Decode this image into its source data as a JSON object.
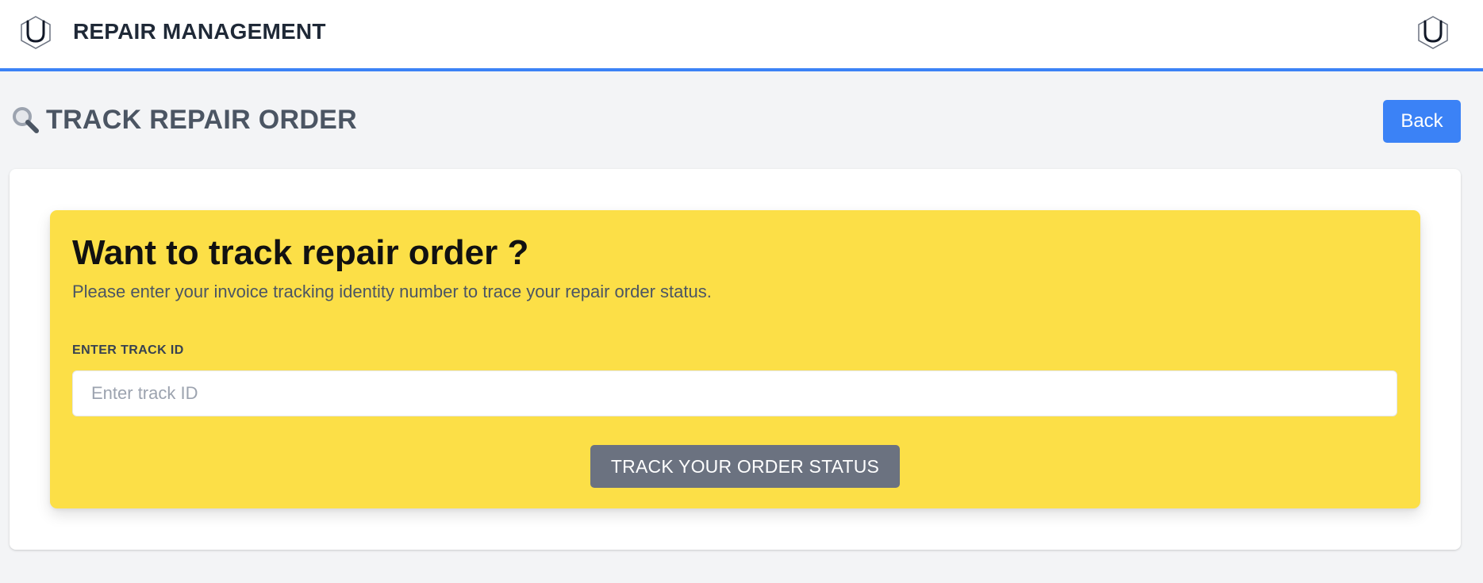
{
  "app": {
    "title": "REPAIR MANAGEMENT",
    "logo_icon": "hexagon-u-logo-icon"
  },
  "header": {
    "title": "TRACK REPAIR ORDER",
    "icon": "search-icon",
    "back_label": "Back"
  },
  "tracker": {
    "heading": "Want to track repair order ?",
    "description": "Please enter your invoice tracking identity number to trace your repair order status.",
    "field_label": "ENTER TRACK ID",
    "input_placeholder": "Enter track ID",
    "input_value": "",
    "submit_label": "TRACK YOUR ORDER STATUS"
  },
  "colors": {
    "accent": "#3b82f6",
    "panel": "#fcdf47",
    "submit": "#6b7280",
    "background": "#f3f4f6"
  }
}
